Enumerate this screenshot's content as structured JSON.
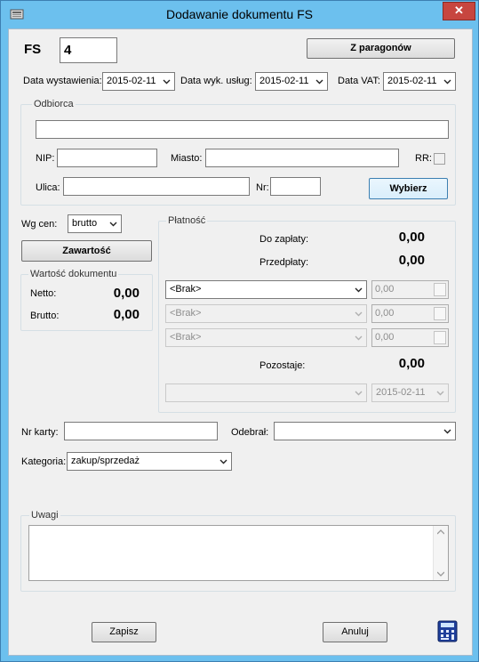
{
  "window": {
    "title": "Dodawanie dokumentu FS",
    "close_glyph": "✕"
  },
  "header": {
    "doc_type": "FS",
    "doc_number": "4",
    "from_receipts_label": "Z paragonów"
  },
  "dates": {
    "issue_label": "Data wystawienia:",
    "issue_value": "2015-02-11",
    "service_label": "Data wyk. usług:",
    "service_value": "2015-02-11",
    "vat_label": "Data VAT:",
    "vat_value": "2015-02-11"
  },
  "recipient": {
    "group_title": "Odbiorca",
    "name_value": "",
    "nip_label": "NIP:",
    "nip_value": "",
    "city_label": "Miasto:",
    "city_value": "",
    "rr_label": "RR:",
    "street_label": "Ulica:",
    "street_value": "",
    "nr_label": "Nr:",
    "nr_value": "",
    "choose_label": "Wybierz"
  },
  "pricing": {
    "label": "Wg cen:",
    "value": "brutto"
  },
  "contents_button": "Zawartość",
  "doc_value": {
    "group_title": "Wartość dokumentu",
    "net_label": "Netto:",
    "net_value": "0,00",
    "gross_label": "Brutto:",
    "gross_value": "0,00"
  },
  "payment": {
    "group_title": "Płatność",
    "to_pay_label": "Do zapłaty:",
    "to_pay_value": "0,00",
    "prepaid_label": "Przedpłaty:",
    "prepaid_value": "0,00",
    "methods": [
      {
        "method": "<Brak>",
        "amount": "0,00",
        "enabled": true
      },
      {
        "method": "<Brak>",
        "amount": "0,00",
        "enabled": false
      },
      {
        "method": "<Brak>",
        "amount": "0,00",
        "enabled": false
      }
    ],
    "remaining_label": "Pozostaje:",
    "remaining_value": "0,00",
    "deferred_method": "",
    "deferred_date": "2015-02-11"
  },
  "card": {
    "label": "Nr karty:",
    "value": "",
    "received_label": "Odebrał:",
    "received_value": ""
  },
  "category": {
    "label": "Kategoria:",
    "value": "zakup/sprzedaż"
  },
  "notes": {
    "group_title": "Uwagi",
    "value": ""
  },
  "footer": {
    "save_label": "Zapisz",
    "cancel_label": "Anuluj",
    "calculator_icon": "calculator-icon"
  }
}
